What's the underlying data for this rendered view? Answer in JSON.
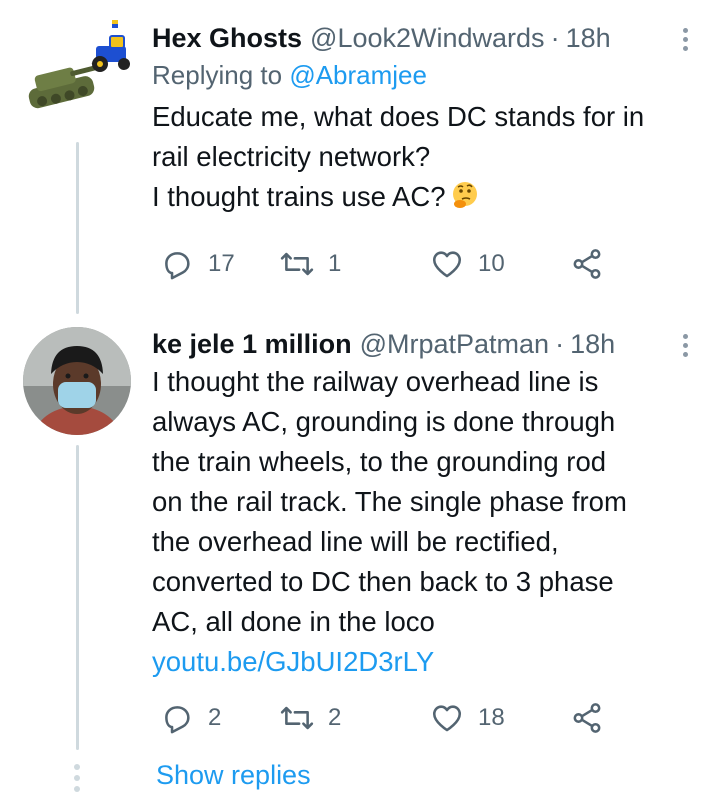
{
  "tweets": [
    {
      "name": "Hex Ghosts",
      "handle": "@Look2Windwards",
      "separator": "·",
      "time": "18h",
      "replying_prefix": "Replying to ",
      "replying_to": "@Abramjee",
      "text": "Educate me, what does DC stands for in\nrail electricity network?\nI thought trains use AC?",
      "emoji": "thinking-face",
      "replies": "17",
      "retweets": "1",
      "likes": "10"
    },
    {
      "name": "ke jele 1 million",
      "handle": "@MrpatPatman",
      "separator": "·",
      "time": "18h",
      "text": "I thought the railway overhead line is\nalways AC, grounding is done through\nthe train wheels, to the grounding rod\non the rail track. The single phase from\nthe overhead line will be rectified,\nconverted to DC then back to 3 phase\nAC, all done in the loco",
      "link": "youtu.be/GJbUI2D3rLY",
      "replies": "2",
      "retweets": "2",
      "likes": "18"
    }
  ],
  "show_replies": "Show replies",
  "colors": {
    "accent": "#1d9bf0",
    "muted": "#536471",
    "line": "#cfd9de"
  },
  "icons": [
    "reply-icon",
    "retweet-icon",
    "like-icon",
    "share-icon",
    "more-icon"
  ]
}
